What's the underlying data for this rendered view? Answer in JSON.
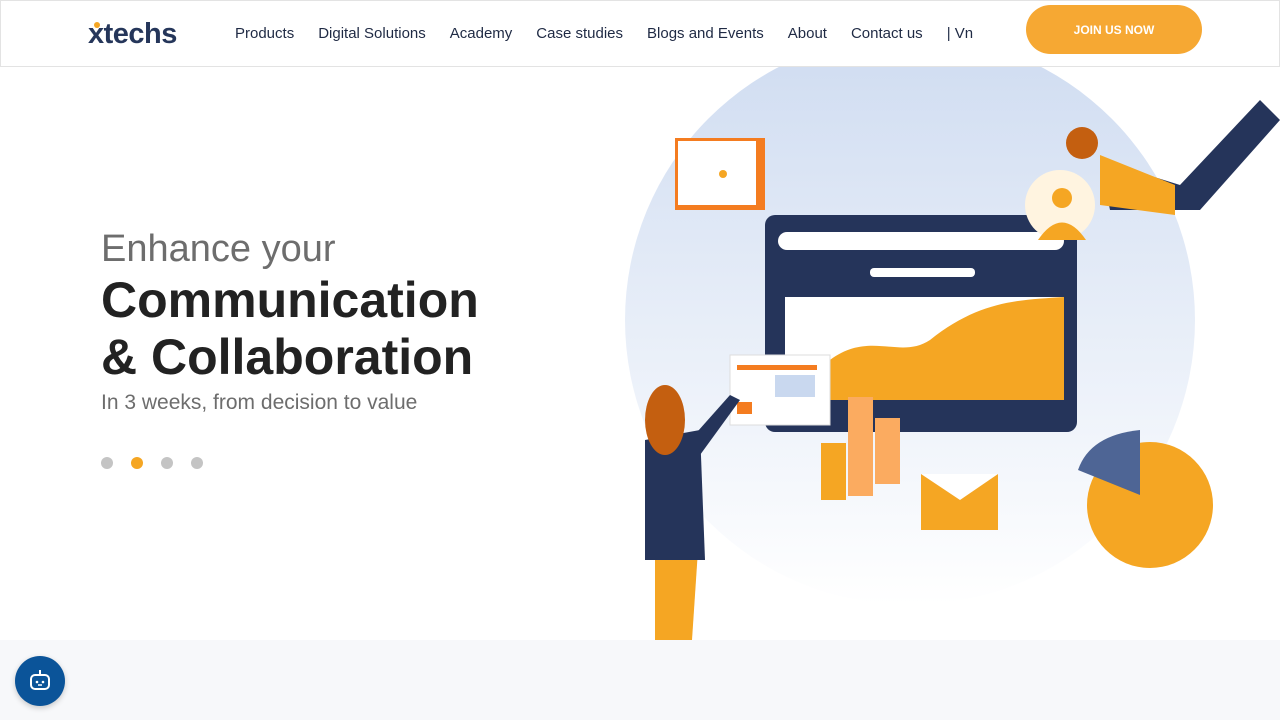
{
  "header": {
    "logo": "xtechs",
    "nav": [
      "Products",
      "Digital Solutions",
      "Academy",
      "Case studies",
      "Blogs and Events",
      "About",
      "Contact us",
      "| Vn"
    ],
    "join_label": "JOIN US NOW"
  },
  "hero": {
    "subtitle": "Enhance your",
    "title_line1": "Communication",
    "title_line2": "& Collaboration",
    "tagline": "In 3 weeks, from decision to value",
    "slide_count": 4,
    "active_slide": 2
  },
  "colors": {
    "accent": "#f5a623",
    "navy": "#25365a",
    "chat": "#0b5499"
  },
  "chat": {
    "icon": "chatbot-icon"
  }
}
